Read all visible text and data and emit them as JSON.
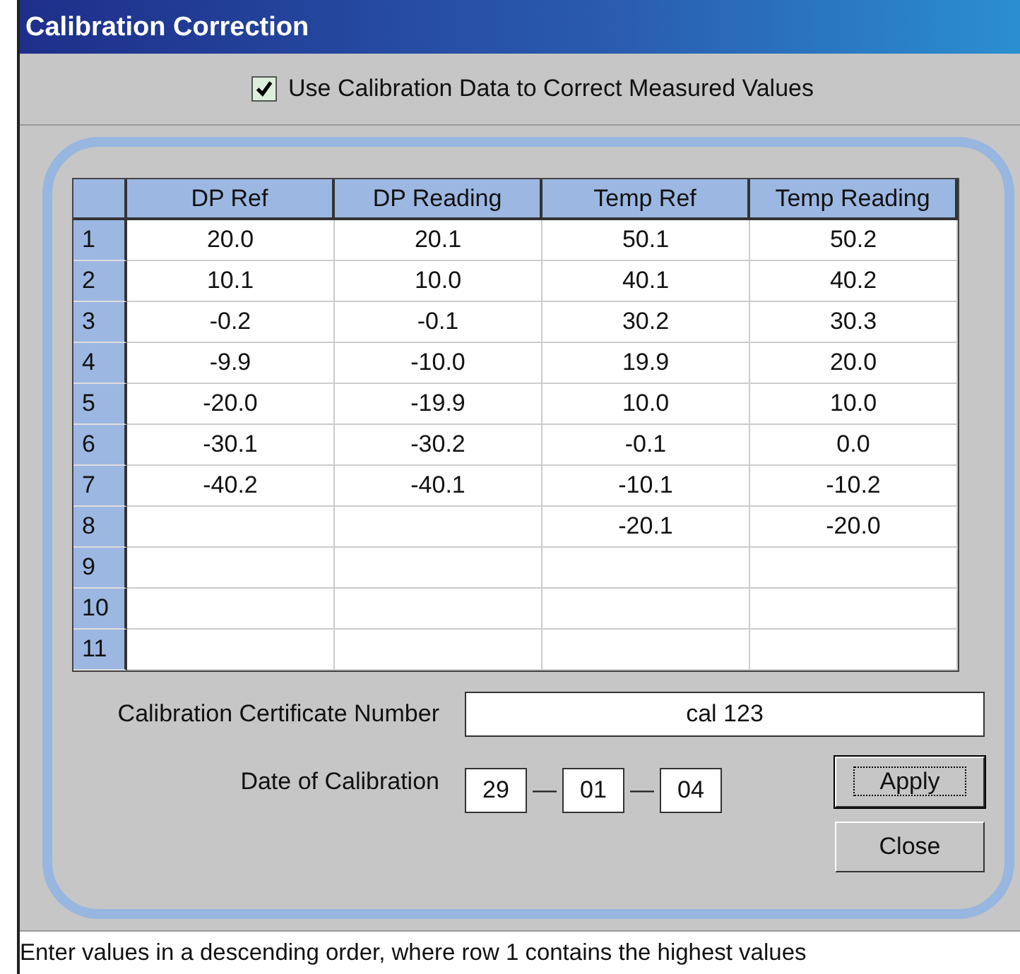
{
  "window": {
    "title": "Calibration Correction"
  },
  "use_calibration": {
    "label": "Use Calibration Data to Correct Measured Values",
    "checked": true
  },
  "table": {
    "columns": [
      "DP Ref",
      "DP Reading",
      "Temp Ref",
      "Temp Reading"
    ],
    "rows": [
      {
        "header": "1",
        "cells": [
          "20.0",
          "20.1",
          "50.1",
          "50.2"
        ]
      },
      {
        "header": "2",
        "cells": [
          "10.1",
          "10.0",
          "40.1",
          "40.2"
        ]
      },
      {
        "header": "3",
        "cells": [
          "-0.2",
          "-0.1",
          "30.2",
          "30.3"
        ]
      },
      {
        "header": "4",
        "cells": [
          "-9.9",
          "-10.0",
          "19.9",
          "20.0"
        ]
      },
      {
        "header": "5",
        "cells": [
          "-20.0",
          "-19.9",
          "10.0",
          "10.0"
        ]
      },
      {
        "header": "6",
        "cells": [
          "-30.1",
          "-30.2",
          "-0.1",
          "0.0"
        ]
      },
      {
        "header": "7",
        "cells": [
          "-40.2",
          "-40.1",
          "-10.1",
          "-10.2"
        ]
      },
      {
        "header": "8",
        "cells": [
          null,
          null,
          "-20.1",
          "-20.0"
        ]
      },
      {
        "header": "9",
        "cells": [
          null,
          null,
          null,
          null
        ]
      },
      {
        "header": "10",
        "cells": [
          null,
          null,
          null,
          null
        ]
      },
      {
        "header": "11",
        "cells": [
          null,
          null,
          null,
          null
        ]
      }
    ]
  },
  "certificate": {
    "label": "Calibration Certificate Number",
    "value": "cal 123"
  },
  "date": {
    "label": "Date of Calibration",
    "day": "29",
    "month": "01",
    "year": "04",
    "separator": "—"
  },
  "buttons": [
    {
      "label": "Apply",
      "focused": true
    },
    {
      "label": "Close",
      "focused": false
    }
  ],
  "status_bar": "Enter values in a descending order, where row 1 contains the highest values"
}
